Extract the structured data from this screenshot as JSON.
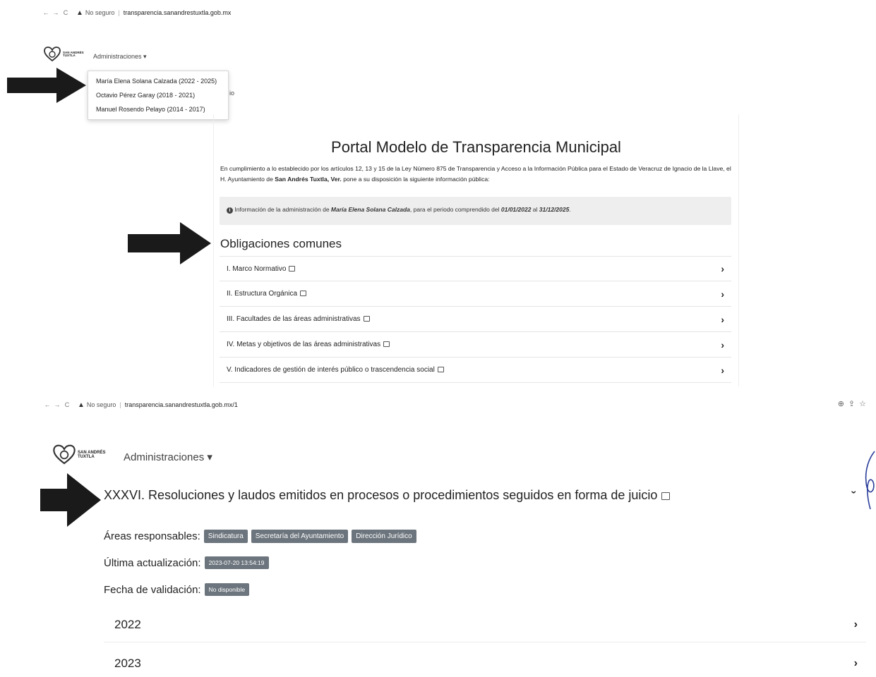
{
  "browser_top": {
    "warning_label": "No seguro",
    "url": "transparencia.sanandrestuxtla.gob.mx"
  },
  "browser_bottom": {
    "warning_label": "No seguro",
    "url": "transparencia.sanandrestuxtla.gob.mx/1"
  },
  "logo": {
    "line1": "SAN ANDRÉS",
    "line2": "TUXTLA"
  },
  "nav": {
    "administrations_label": "Administraciones ▾"
  },
  "dropdown": {
    "items": [
      {
        "label": "María Elena Solana Calzada (2022 - 2025)"
      },
      {
        "label": "Octavio Pérez Garay (2018 - 2021)"
      },
      {
        "label": "Manuel Rosendo Pelayo (2014 - 2017)"
      }
    ]
  },
  "behind_text": "io",
  "portal": {
    "title": "Portal Modelo de Transparencia Municipal",
    "intro_part1": "En cumplimiento a lo establecido por los artículos 12, 13 y 15 de la Ley Número 875 de Transparencia y Acceso a la Información Pública para el Estado de Veracruz de Ignacio de la Llave, el H. Ayuntamiento de ",
    "intro_bold": "San Andrés Tuxtla, Ver.",
    "intro_part2": " pone a su disposición la siguiente información pública:",
    "info_icon": "info-circle-icon",
    "info_part1": "Información de la administración de ",
    "info_name": "María Elena Solana Calzada",
    "info_part2": ", para el periodo comprendido del ",
    "info_from": "01/01/2022",
    "info_and": " al ",
    "info_to": "31/12/2025",
    "info_end": "."
  },
  "obligations": {
    "title": "Obligaciones comunes",
    "items": [
      {
        "label": "I. Marco Normativo"
      },
      {
        "label": "II. Estructura Orgánica"
      },
      {
        "label": "III. Facultades de las áreas administrativas"
      },
      {
        "label": "IV. Metas y objetivos de las áreas administrativas"
      },
      {
        "label": "V. Indicadores de gestión de interés público o trascendencia social"
      }
    ]
  },
  "browser_icons": [
    "zoom-icon",
    "share-icon",
    "star-icon"
  ],
  "section": {
    "title": "XXXVI. Resoluciones y laudos emitidos en procesos o procedimientos seguidos en forma de juicio",
    "areas_label": "Áreas responsables:",
    "areas": [
      "Sindicatura",
      "Secretaría del Ayuntamiento",
      "Dirección Jurídico"
    ],
    "updated_label": "Última actualización:",
    "updated_value": "2023-07-20 13:54:19",
    "validation_label": "Fecha de validación:",
    "validation_value": "No disponible",
    "years": [
      "2022",
      "2023"
    ]
  }
}
